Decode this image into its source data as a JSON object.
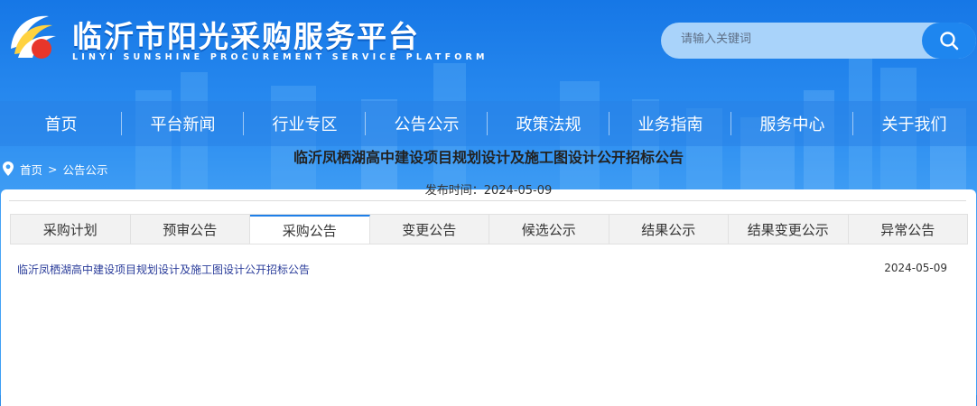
{
  "header": {
    "title": "临沂市阳光采购服务平台",
    "subtitle": "LINYI SUNSHINE PROCUREMENT SERVICE PLATFORM",
    "logo_icon": "sunburst-logo-icon"
  },
  "search": {
    "placeholder": "请输入关键词",
    "button_icon": "search-icon"
  },
  "nav": {
    "items": [
      {
        "label": "首页"
      },
      {
        "label": "平台新闻"
      },
      {
        "label": "行业专区"
      },
      {
        "label": "公告公示"
      },
      {
        "label": "政策法规"
      },
      {
        "label": "业务指南"
      },
      {
        "label": "服务中心"
      },
      {
        "label": "关于我们"
      }
    ]
  },
  "breadcrumb": {
    "icon": "location-pin-icon",
    "home": "首页",
    "separator": ">",
    "current": "公告公示"
  },
  "tabs": {
    "items": [
      {
        "label": "采购计划"
      },
      {
        "label": "预审公告"
      },
      {
        "label": "采购公告",
        "active": true
      },
      {
        "label": "变更公告"
      },
      {
        "label": "候选公示"
      },
      {
        "label": "结果公示"
      },
      {
        "label": "结果变更公示"
      },
      {
        "label": "异常公告"
      }
    ]
  },
  "list": {
    "rows": [
      {
        "title": "临沂凤栖湖高中建设项目规划设计及施工图设计公开招标公告",
        "date": "2024-05-09"
      }
    ]
  },
  "article": {
    "title": "临沂凤栖湖高中建设项目规划设计及施工图设计公开招标公告",
    "publish_label": "发布时间：2024-05-09"
  },
  "colors": {
    "primary": "#1e86ef",
    "link": "#2a3c9a",
    "tab_active_border": "#1e7fe8"
  }
}
